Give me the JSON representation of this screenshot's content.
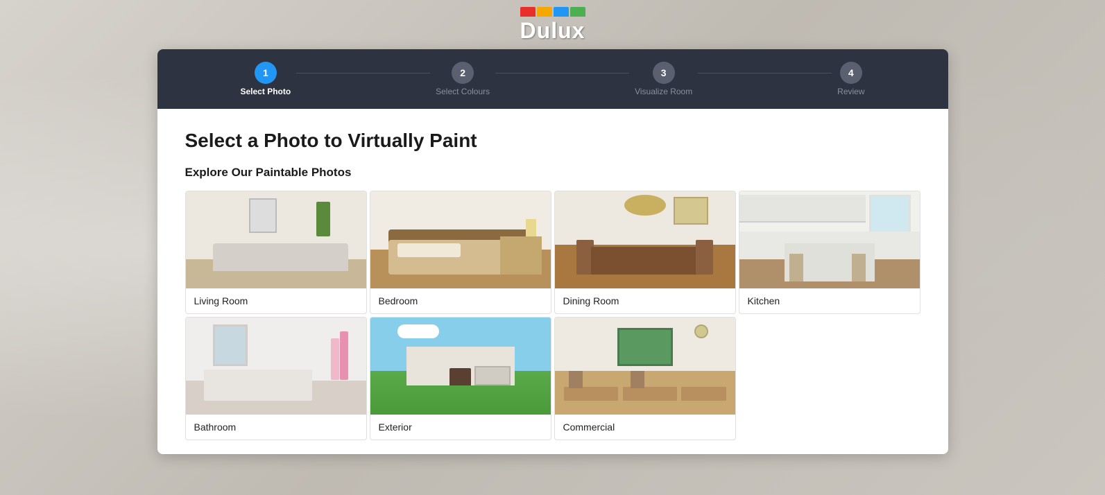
{
  "header": {
    "logo_text": "Dulux"
  },
  "stepper": {
    "steps": [
      {
        "number": "1",
        "label": "Select Photo",
        "state": "active"
      },
      {
        "number": "2",
        "label": "Select Colours",
        "state": "inactive"
      },
      {
        "number": "3",
        "label": "Visualize Room",
        "state": "inactive"
      },
      {
        "number": "4",
        "label": "Review",
        "state": "inactive"
      }
    ]
  },
  "content": {
    "page_title": "Select a Photo to Virtually Paint",
    "section_title": "Explore Our Paintable Photos",
    "rooms": [
      {
        "id": "living-room",
        "label": "Living Room",
        "scene_class": "scene-living"
      },
      {
        "id": "bedroom",
        "label": "Bedroom",
        "scene_class": "scene-bedroom"
      },
      {
        "id": "dining-room",
        "label": "Dining Room",
        "scene_class": "scene-dining"
      },
      {
        "id": "kitchen",
        "label": "Kitchen",
        "scene_class": "scene-kitchen"
      },
      {
        "id": "bathroom",
        "label": "Bathroom",
        "scene_class": "scene-bathroom"
      },
      {
        "id": "exterior",
        "label": "Exterior",
        "scene_class": "scene-exterior"
      },
      {
        "id": "commercial",
        "label": "Commercial",
        "scene_class": "scene-commercial"
      }
    ]
  },
  "colors": {
    "stepper_bg": "#2d3340",
    "active_step": "#2196f3",
    "inactive_step": "#5a6070",
    "accent": "#2196f3"
  }
}
